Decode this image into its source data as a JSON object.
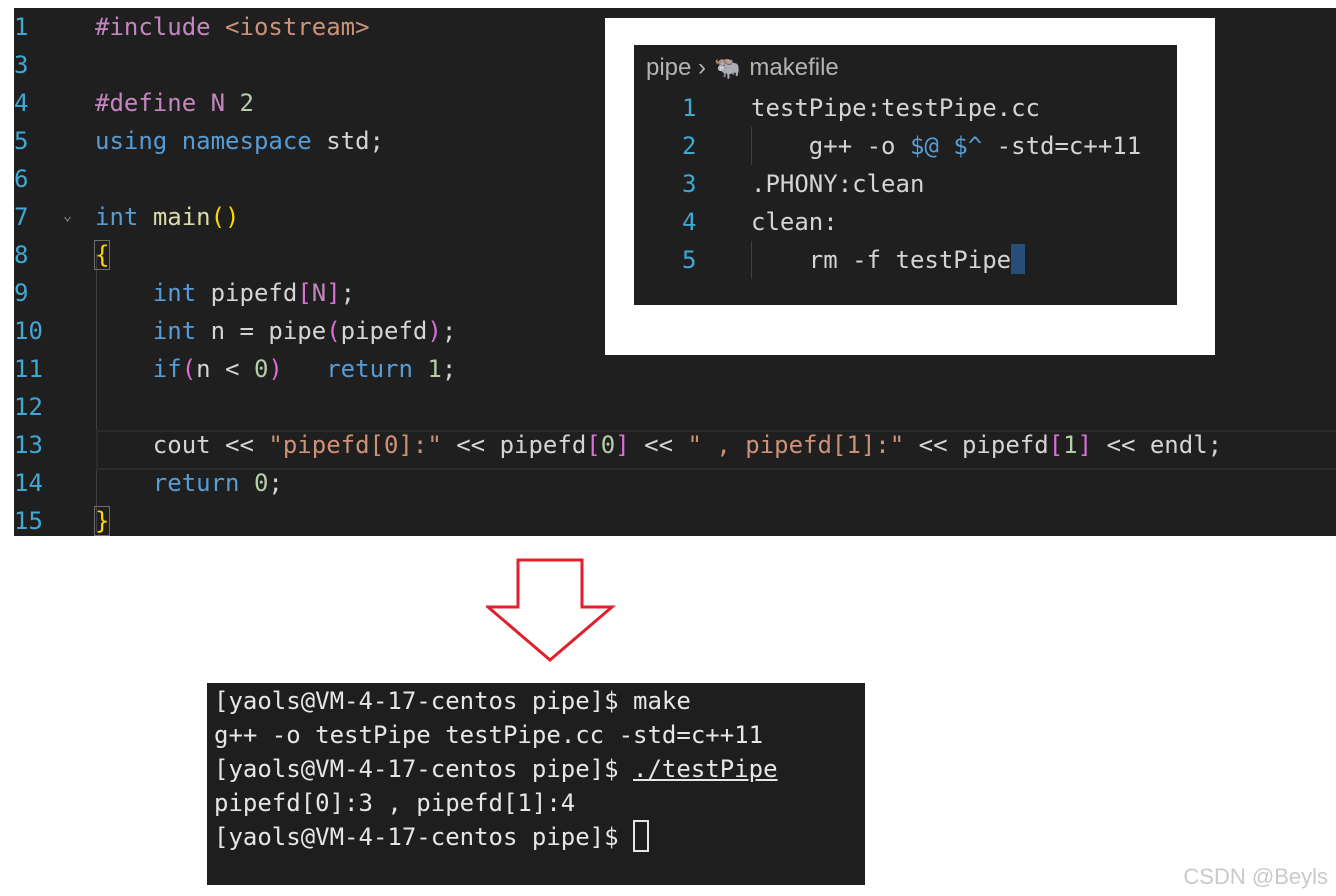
{
  "editor": {
    "lines": [
      {
        "num": "1",
        "tokens": [
          {
            "c": "pp",
            "t": "#include "
          },
          {
            "c": "s",
            "t": "<iostream>"
          }
        ]
      },
      {
        "num": "3",
        "tokens": []
      },
      {
        "num": "4",
        "tokens": [
          {
            "c": "pp",
            "t": "#define "
          },
          {
            "c": "pp",
            "t": "N"
          },
          {
            "c": "",
            "t": " "
          },
          {
            "c": "n",
            "t": "2"
          }
        ]
      },
      {
        "num": "5",
        "tokens": [
          {
            "c": "k",
            "t": "using"
          },
          {
            "c": "",
            "t": " "
          },
          {
            "c": "k",
            "t": "namespace"
          },
          {
            "c": "",
            "t": " std;"
          }
        ]
      },
      {
        "num": "6",
        "tokens": []
      },
      {
        "num": "7",
        "fold": true,
        "tokens": [
          {
            "c": "k",
            "t": "int"
          },
          {
            "c": "",
            "t": " "
          },
          {
            "c": "f",
            "t": "main"
          },
          {
            "c": "p1",
            "t": "()"
          }
        ]
      },
      {
        "num": "8",
        "tokens": [
          {
            "c": "p1 brk",
            "t": "{"
          }
        ]
      },
      {
        "num": "9",
        "tokens": [
          {
            "c": "",
            "t": "    "
          },
          {
            "c": "k",
            "t": "int"
          },
          {
            "c": "",
            "t": " pipefd"
          },
          {
            "c": "p2",
            "t": "["
          },
          {
            "c": "pp",
            "t": "N"
          },
          {
            "c": "p2",
            "t": "]"
          },
          {
            "c": "",
            "t": ";"
          }
        ]
      },
      {
        "num": "10",
        "tokens": [
          {
            "c": "",
            "t": "    "
          },
          {
            "c": "k",
            "t": "int"
          },
          {
            "c": "",
            "t": " n = pipe"
          },
          {
            "c": "p2",
            "t": "("
          },
          {
            "c": "",
            "t": "pipefd"
          },
          {
            "c": "p2",
            "t": ")"
          },
          {
            "c": "",
            "t": ";"
          }
        ]
      },
      {
        "num": "11",
        "tokens": [
          {
            "c": "",
            "t": "    "
          },
          {
            "c": "k",
            "t": "if"
          },
          {
            "c": "p2",
            "t": "("
          },
          {
            "c": "",
            "t": "n < "
          },
          {
            "c": "n",
            "t": "0"
          },
          {
            "c": "p2",
            "t": ")"
          },
          {
            "c": "",
            "t": "   "
          },
          {
            "c": "k",
            "t": "return"
          },
          {
            "c": "",
            "t": " "
          },
          {
            "c": "n",
            "t": "1"
          },
          {
            "c": "",
            "t": ";"
          }
        ]
      },
      {
        "num": "12",
        "tokens": []
      },
      {
        "num": "13",
        "tokens": [
          {
            "c": "",
            "t": "    cout << "
          },
          {
            "c": "s",
            "t": "\"pipefd[0]:\""
          },
          {
            "c": "",
            "t": " << pipefd"
          },
          {
            "c": "p2",
            "t": "["
          },
          {
            "c": "n",
            "t": "0"
          },
          {
            "c": "p2",
            "t": "]"
          },
          {
            "c": "",
            "t": " << "
          },
          {
            "c": "s",
            "t": "\" , pipefd[1]:\""
          },
          {
            "c": "",
            "t": " << pipefd"
          },
          {
            "c": "p2",
            "t": "["
          },
          {
            "c": "n",
            "t": "1"
          },
          {
            "c": "p2",
            "t": "]"
          },
          {
            "c": "",
            "t": " << endl;"
          }
        ]
      },
      {
        "num": "14",
        "tokens": [
          {
            "c": "",
            "t": "    "
          },
          {
            "c": "k",
            "t": "return"
          },
          {
            "c": "",
            "t": " "
          },
          {
            "c": "n",
            "t": "0"
          },
          {
            "c": "",
            "t": ";"
          }
        ]
      },
      {
        "num": "15",
        "tokens": [
          {
            "c": "p1 brk",
            "t": "}"
          }
        ]
      }
    ]
  },
  "makefile": {
    "breadcrumb_folder": "pipe",
    "breadcrumb_sep": "›",
    "breadcrumb_icon": "gnu-icon",
    "breadcrumb_file": "makefile",
    "lines": [
      {
        "num": "1",
        "guide": false,
        "tokens": [
          {
            "c": "",
            "t": "testPipe:testPipe.cc"
          }
        ]
      },
      {
        "num": "2",
        "guide": true,
        "tokens": [
          {
            "c": "",
            "t": "    g++ -o "
          },
          {
            "c": "k",
            "t": "$@"
          },
          {
            "c": "",
            "t": " "
          },
          {
            "c": "k",
            "t": "$^"
          },
          {
            "c": "",
            "t": " -std=c++11"
          }
        ]
      },
      {
        "num": "3",
        "guide": false,
        "tokens": [
          {
            "c": "",
            "t": ".PHONY:clean"
          }
        ]
      },
      {
        "num": "4",
        "guide": false,
        "tokens": [
          {
            "c": "",
            "t": "clean:"
          }
        ]
      },
      {
        "num": "5",
        "guide": true,
        "cursor": true,
        "tokens": [
          {
            "c": "",
            "t": "    rm -f testPipe"
          }
        ]
      }
    ]
  },
  "arrow": {
    "color": "#e0202a",
    "icon": "down-arrow-icon"
  },
  "terminal": {
    "lines": [
      {
        "text": "[yaols@VM-4-17-centos pipe]$ make"
      },
      {
        "text": "g++ -o testPipe testPipe.cc -std=c++11"
      },
      {
        "prefix": "[yaols@VM-4-17-centos pipe]$ ",
        "underlined": "./testPipe"
      },
      {
        "text": "pipefd[0]:3 , pipefd[1]:4"
      },
      {
        "prefix": "[yaols@VM-4-17-centos pipe]$ ",
        "cursor": true
      }
    ]
  },
  "watermark": "CSDN @Beyls"
}
